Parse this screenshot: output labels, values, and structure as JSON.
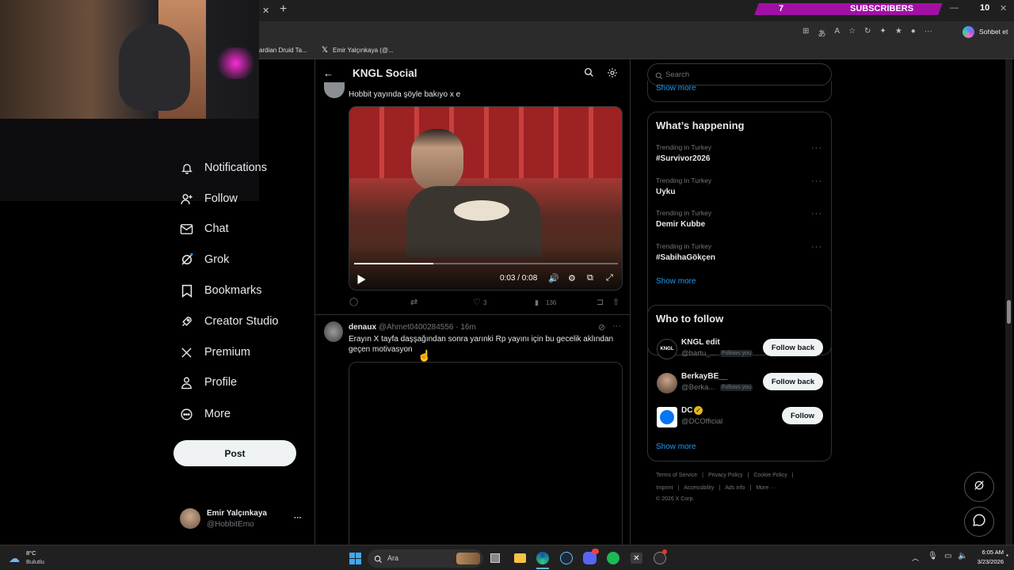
{
  "browser": {
    "tab_close": "✕",
    "tab_new": "+",
    "subscriber_count": "7",
    "subscriber_label": "SUBSCRIBERS",
    "notification_count": "10",
    "copilot_label": "Sohbet et",
    "bookmark_1": "ardian Druid Ta...",
    "bookmark_2": "Emir Yalçınkaya (@..."
  },
  "header": {
    "title": "KNGL Social"
  },
  "sidebar": {
    "items": [
      {
        "label": "Notifications",
        "icon": "bell-icon"
      },
      {
        "label": "Follow",
        "icon": "person-add-icon"
      },
      {
        "label": "Chat",
        "icon": "mail-icon"
      },
      {
        "label": "Grok",
        "icon": "grok-icon"
      },
      {
        "label": "Bookmarks",
        "icon": "bookmark-icon"
      },
      {
        "label": "Creator Studio",
        "icon": "rocket-icon"
      },
      {
        "label": "Premium",
        "icon": "x-logo-icon"
      },
      {
        "label": "Profile",
        "icon": "person-icon"
      },
      {
        "label": "More",
        "icon": "more-circle-icon"
      }
    ],
    "post_button": "Post",
    "account": {
      "name": "Emir Yalçınkaya",
      "handle": "@HobbitEmo",
      "more": "···"
    }
  },
  "feed": {
    "post1": {
      "text": "Hobbit yayında şöyle bakıyo x e",
      "video": {
        "time": "0:03 / 0:08",
        "progress": 0.3
      },
      "likes": "3",
      "views": "136"
    },
    "post2": {
      "name": "denaux",
      "handle": "@Ahmet0400284556",
      "time": "· 16m",
      "text": "Erayın X tayfa daşşağından sonra yarınki Rp yayını için bu gecelik aklından geçen motivasyon"
    }
  },
  "right": {
    "search_placeholder": "Search",
    "show_more_top": "Show more",
    "happening_title": "What’s happening",
    "trends": [
      {
        "meta": "Trending in Turkey",
        "tag": "#Survivor2026"
      },
      {
        "meta": "Trending in Turkey",
        "tag": "Uyku"
      },
      {
        "meta": "Trending in Turkey",
        "tag": "Demir Kubbe"
      },
      {
        "meta": "Trending in Turkey",
        "tag": "#SabihaGökçen"
      }
    ],
    "show_more_trends": "Show more",
    "who_title": "Who to follow",
    "follow": [
      {
        "name": "KNGL edit",
        "handle": "@bartu_...",
        "badge": "Follows you",
        "button": "Follow back"
      },
      {
        "name": "BerkayBE__",
        "handle": "@Berka...",
        "badge": "Follows you",
        "button": "Follow back"
      },
      {
        "name": "DC",
        "handle": "@DCOfficial",
        "badge": "",
        "button": "Follow"
      }
    ],
    "show_more_follow": "Show more",
    "footer": {
      "line1": [
        "Terms of Service",
        "|",
        "Privacy Policy",
        "|",
        "Cookie Policy",
        "|"
      ],
      "line2": [
        "Imprint",
        "|",
        "Accessibility",
        "|",
        "Ads info",
        "|",
        "More ···"
      ],
      "copyright": "© 2026 X Corp."
    }
  },
  "taskbar": {
    "temp": "8°C",
    "weather": "Bulutlu",
    "search": "Ara",
    "time": "6:05 AM",
    "date": "3/23/2026"
  },
  "colors": {
    "accent": "#1d9bf0",
    "subscriber_bar": "#a20fa5"
  }
}
